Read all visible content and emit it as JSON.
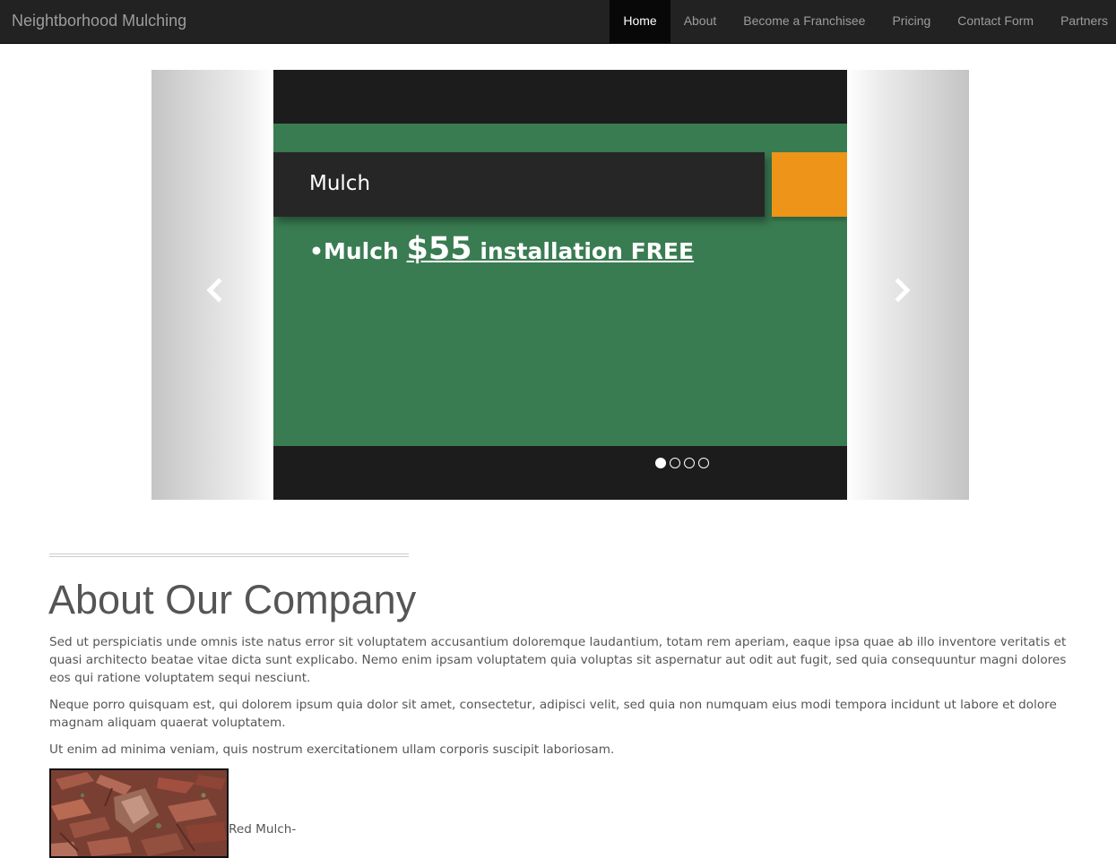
{
  "navbar": {
    "brand": "Neightborhood Mulching",
    "items": [
      {
        "label": "Home",
        "active": true
      },
      {
        "label": "About",
        "active": false
      },
      {
        "label": "Become a Franchisee",
        "active": false
      },
      {
        "label": "Pricing",
        "active": false
      },
      {
        "label": "Contact Form",
        "active": false
      },
      {
        "label": "Partners",
        "active": false
      }
    ]
  },
  "carousel": {
    "slide_title": "Mulch",
    "slide_text_prefix": "•Mulch ",
    "slide_price": "$55",
    "slide_text_suffix": " installation FREE",
    "prev_icon": "chevron-left-icon",
    "next_icon": "chevron-right-icon",
    "indicator_count": 4,
    "active_indicator": 1,
    "colors": {
      "frame": "#1c1c1c",
      "green": "#3a7c52",
      "title_bar": "#262626",
      "orange": "#ee9419"
    }
  },
  "about": {
    "title": "About Our Company",
    "paragraphs": [
      "Sed ut perspiciatis unde omnis iste natus error sit voluptatem accusantium doloremque laudantium, totam rem aperiam, eaque ipsa quae ab illo inventore veritatis et quasi architecto beatae vitae dicta sunt explicabo. Nemo enim ipsam voluptatem quia voluptas sit aspernatur aut odit aut fugit, sed quia consequuntur magni dolores eos qui ratione voluptatem sequi nesciunt.",
      "Neque porro quisquam est, qui dolorem ipsum quia dolor sit amet, consectetur, adipisci velit, sed quia non numquam eius modi tempora incidunt ut labore et dolore magnam aliquam quaerat voluptatem.",
      "Ut enim ad minima veniam, quis nostrum exercitationem ullam corporis suscipit laboriosam."
    ],
    "product_caption": "Red Mulch-"
  }
}
